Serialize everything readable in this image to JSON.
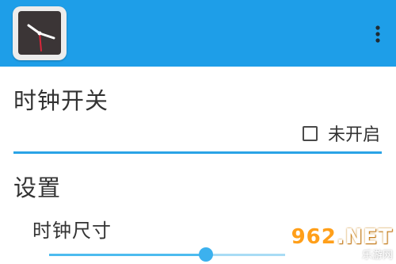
{
  "appbar": {
    "app_icon_name": "clock-app-icon",
    "overflow_icon_name": "more-vertical-icon",
    "background_color": "#1e9ee8"
  },
  "clock_switch": {
    "title": "时钟开关",
    "checkbox_label": "未开启",
    "checked": false
  },
  "settings": {
    "title": "设置",
    "clock_size_label": "时钟尺寸",
    "clock_size_value": 0.67,
    "accent_color": "#3cb1ee"
  },
  "watermark": {
    "main_number": "962",
    "main_suffix": ".NET",
    "sub": "乐游网"
  }
}
